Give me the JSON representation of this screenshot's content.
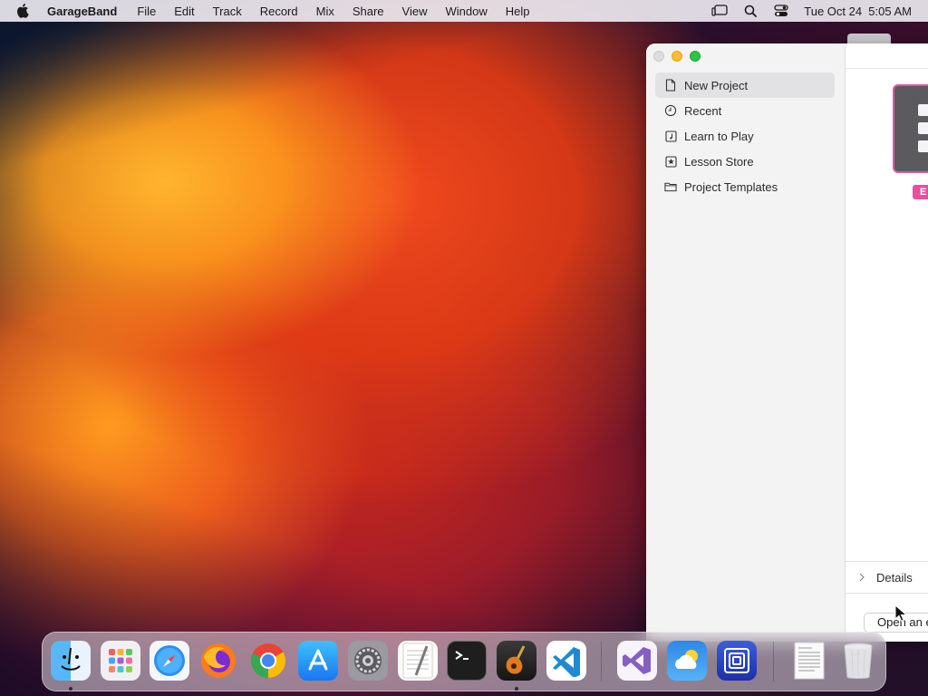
{
  "menubar": {
    "app_name": "GarageBand",
    "items": [
      "File",
      "Edit",
      "Track",
      "Record",
      "Mix",
      "Share",
      "View",
      "Window",
      "Help"
    ],
    "clock": "Tue Oct 24  5:05 AM"
  },
  "window": {
    "sidebar": {
      "items": [
        {
          "label": "New Project",
          "icon": "document-icon",
          "selected": true
        },
        {
          "label": "Recent",
          "icon": "clock-icon",
          "selected": false
        },
        {
          "label": "Learn to Play",
          "icon": "music-note-icon",
          "selected": false
        },
        {
          "label": "Lesson Store",
          "icon": "star-icon",
          "selected": false
        },
        {
          "label": "Project Templates",
          "icon": "folder-icon",
          "selected": false
        }
      ]
    },
    "content": {
      "template_badge": "E",
      "details_label": "Details",
      "open_button_label": "Open an e"
    }
  },
  "dock": {
    "apps": [
      "Finder",
      "Launchpad",
      "Safari",
      "Firefox",
      "Chrome",
      "App Store",
      "System Settings",
      "TextEdit",
      "Terminal",
      "GarageBand",
      "Visual Studio Code",
      "Visual Studio",
      "Weather",
      "Screen Sharing",
      "Document",
      "Trash"
    ]
  },
  "colors": {
    "accent_pink": "#e8509e",
    "traffic_min": "#febc2e",
    "traffic_max": "#28c840"
  }
}
